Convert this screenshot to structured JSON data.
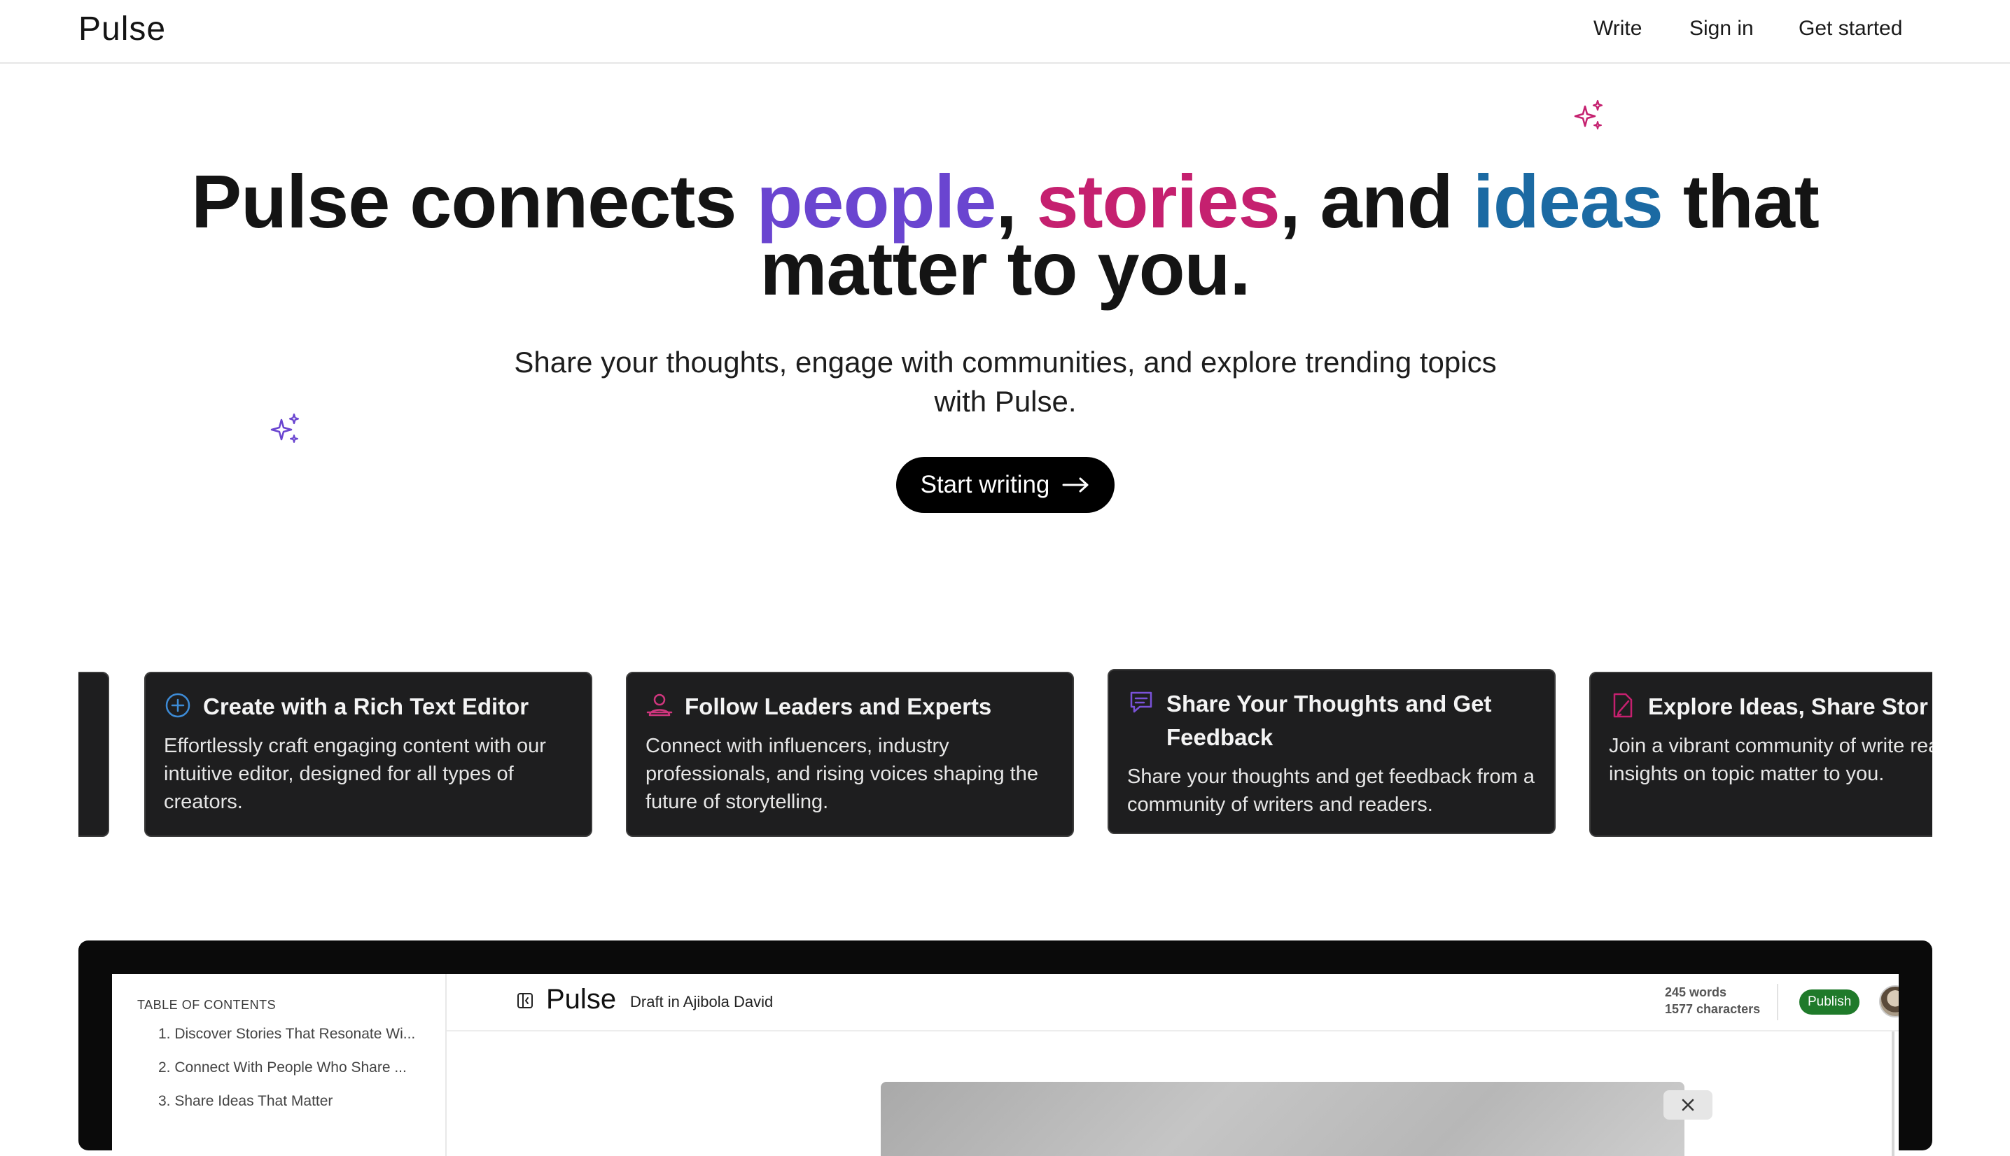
{
  "nav": {
    "logo": "Pulse",
    "write": "Write",
    "signin": "Sign in",
    "get_started": "Get started"
  },
  "hero": {
    "title_part1": "Pulse connects ",
    "word_people": "people",
    "sep1": ", ",
    "word_stories": "stories",
    "sep2": ", and ",
    "word_ideas": "ideas",
    "title_part2": " that",
    "title_line2": "matter to you.",
    "subtitle_line1": "Share your thoughts, engage with communities, and explore trending topics",
    "subtitle_line2": "with Pulse.",
    "cta_label": "Start writing"
  },
  "features": [
    {
      "title": "Create with a Rich Text Editor",
      "text": "Effortlessly craft engaging content with our intuitive editor, designed for all types of creators."
    },
    {
      "title": "Follow Leaders and Experts",
      "text": "Connect with influencers, industry professionals, and rising voices shaping the future of storytelling."
    },
    {
      "title": "Share Your Thoughts and Get Feedback",
      "text": "Share your thoughts and get feedback from a community of writers and readers."
    },
    {
      "title": "Explore Ideas, Share Stor",
      "text": "Join a vibrant community of write readers, sharing insights on topic matter to you."
    }
  ],
  "preview": {
    "toc_heading": "TABLE OF CONTENTS",
    "toc_items": [
      "1. Discover Stories That Resonate Wi...",
      "2. Connect With People Who Share ...",
      "3. Share Ideas That Matter"
    ],
    "app_logo": "Pulse",
    "draft_label": "Draft in Ajibola David",
    "words": "245 words",
    "characters": "1577 characters",
    "publish_label": "Publish"
  },
  "colors": {
    "people": "#6a45d0",
    "stories": "#c5206f",
    "ideas": "#1b6aa3",
    "publish": "#1f7a2a"
  }
}
